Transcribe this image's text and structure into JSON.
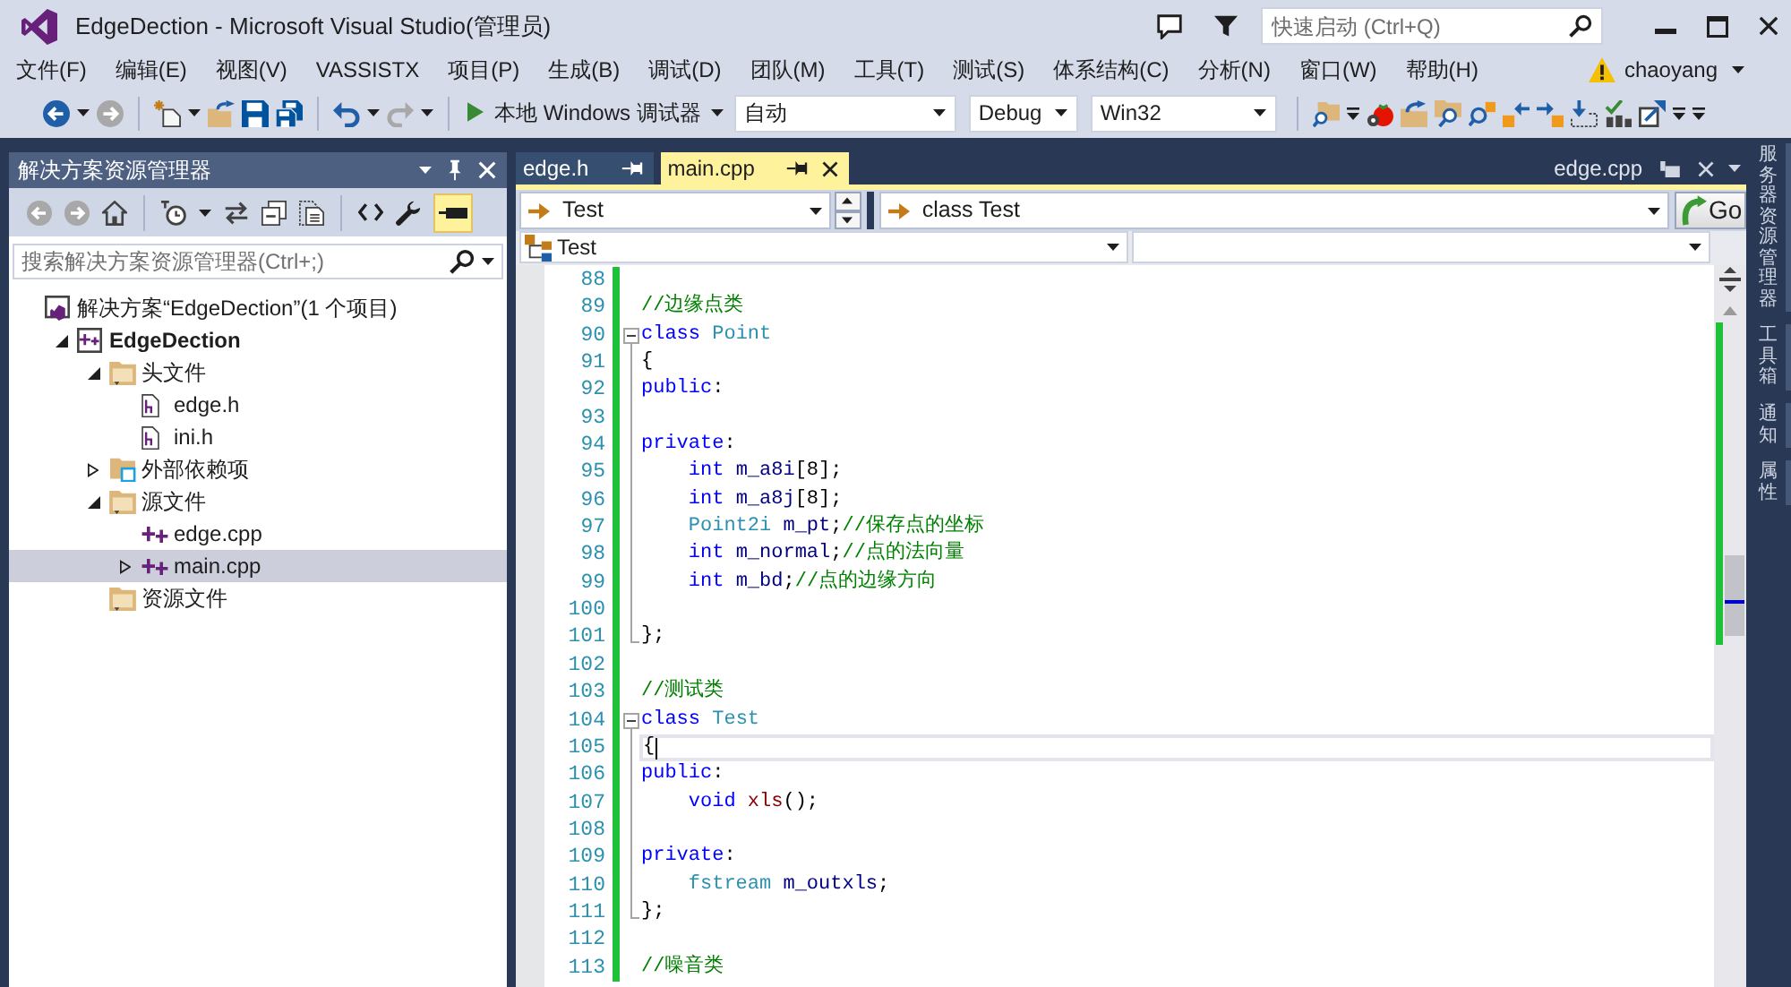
{
  "window": {
    "title": "EdgeDection - Microsoft Visual Studio(管理员)",
    "quick_launch": {
      "placeholder": "快速启动 (Ctrl+Q)"
    }
  },
  "menu": [
    "文件(F)",
    "编辑(E)",
    "视图(V)",
    "VASSISTX",
    "项目(P)",
    "生成(B)",
    "调试(D)",
    "团队(M)",
    "工具(T)",
    "测试(S)",
    "体系结构(C)",
    "分析(N)",
    "窗口(W)",
    "帮助(H)"
  ],
  "account": {
    "warning": true,
    "user": "chaoyang"
  },
  "toolbar": {
    "items": [
      {
        "kind": "back",
        "disabled": false,
        "menu": true
      },
      {
        "kind": "forward",
        "disabled": true
      },
      {
        "kind": "separator"
      },
      {
        "kind": "new-project",
        "disabled": false,
        "menu": true
      },
      {
        "kind": "open-file",
        "disabled": false
      },
      {
        "kind": "save",
        "disabled": false
      },
      {
        "kind": "save-all",
        "disabled": false
      },
      {
        "kind": "separator"
      },
      {
        "kind": "undo",
        "disabled": false,
        "menu": true
      },
      {
        "kind": "redo",
        "disabled": true,
        "menu": true
      },
      {
        "kind": "separator"
      },
      {
        "kind": "start",
        "label": "本地 Windows 调试器",
        "menu": true
      },
      {
        "kind": "debugger-type-combo",
        "value": "自动"
      },
      {
        "kind": "configuration-combo",
        "value": "Debug"
      },
      {
        "kind": "platform-combo",
        "value": "Win32"
      },
      {
        "kind": "separator"
      },
      {
        "kind": "find-in-files",
        "disabled": false
      },
      {
        "kind": "overflow"
      },
      {
        "kind": "tomato",
        "disabled": false
      },
      {
        "kind": "folder-arrow",
        "disabled": false
      },
      {
        "kind": "folder-magnifier",
        "disabled": false
      },
      {
        "kind": "magnifier",
        "disabled": false
      },
      {
        "kind": "arrow-left",
        "disabled": false
      },
      {
        "kind": "arrow-right",
        "disabled": false
      },
      {
        "kind": "arrow-down",
        "disabled": false
      },
      {
        "kind": "spell-check",
        "disabled": false
      },
      {
        "kind": "window-arrow",
        "disabled": false
      },
      {
        "kind": "overflow"
      },
      {
        "kind": "overflow"
      }
    ]
  },
  "solution_explorer": {
    "title": "解决方案资源管理器",
    "toolbar": [
      {
        "kind": "back",
        "disabled": true
      },
      {
        "kind": "forward",
        "disabled": true
      },
      {
        "kind": "home",
        "disabled": false
      },
      {
        "kind": "separator"
      },
      {
        "kind": "pending-changes",
        "disabled": false,
        "menu": true
      },
      {
        "kind": "sync",
        "disabled": false
      },
      {
        "kind": "collapse-all",
        "disabled": false
      },
      {
        "kind": "show-all-files",
        "disabled": false
      },
      {
        "kind": "separator"
      },
      {
        "kind": "view-code",
        "disabled": false
      },
      {
        "kind": "properties",
        "disabled": false
      },
      {
        "kind": "preview",
        "disabled": false,
        "on": true
      }
    ],
    "search": {
      "placeholder": "搜索解决方案资源管理器(Ctrl+;)"
    },
    "tree": [
      {
        "kind": "solution",
        "label": "解决方案“EdgeDection”(1 个项目)",
        "selected": false,
        "children": [
          {
            "kind": "project",
            "label": "EdgeDection",
            "expanded": true,
            "selected": false,
            "children": [
              {
                "kind": "filter",
                "label": "头文件",
                "expanded": true,
                "selected": false,
                "children": [
                  {
                    "kind": "header",
                    "label": "edge.h",
                    "selected": false
                  },
                  {
                    "kind": "header",
                    "label": "ini.h",
                    "selected": false
                  }
                ]
              },
              {
                "kind": "external",
                "label": "外部依赖项",
                "expanded": false,
                "selected": false
              },
              {
                "kind": "filter",
                "label": "源文件",
                "expanded": true,
                "selected": false,
                "children": [
                  {
                    "kind": "source",
                    "label": "edge.cpp",
                    "selected": false
                  },
                  {
                    "kind": "source",
                    "label": "main.cpp",
                    "expanded": false,
                    "selected": true
                  }
                ]
              },
              {
                "kind": "filter",
                "label": "资源文件",
                "selected": false
              }
            ]
          }
        ]
      }
    ]
  },
  "editor": {
    "tabs": [
      {
        "label": "edge.h",
        "selected": false
      },
      {
        "label": "main.cpp",
        "selected": true
      }
    ],
    "preview_tab": {
      "label": "edge.cpp"
    },
    "va_bar": {
      "context": "Test",
      "definition": "class Test",
      "go": "Go"
    },
    "nav_bar": {
      "scope": "Test"
    },
    "lines": [
      {
        "number": "88",
        "kind": "plain",
        "changed": true,
        "current": false
      },
      {
        "number": "89",
        "kind": "plain",
        "changed": true,
        "current": false,
        "tokens": [
          {
            "kind": "comment",
            "text": "//边缘点类"
          }
        ]
      },
      {
        "number": "90",
        "kind": "opener",
        "changed": true,
        "current": false,
        "tokens": [
          {
            "kind": "keyword",
            "text": "class"
          },
          {
            "kind": "type",
            "text": " Point"
          }
        ]
      },
      {
        "number": "91",
        "kind": "inner",
        "changed": true,
        "current": false,
        "tokens": [
          {
            "kind": "plain",
            "text": "{"
          }
        ]
      },
      {
        "number": "92",
        "kind": "inner",
        "changed": true,
        "current": false,
        "tokens": [
          {
            "kind": "keyword",
            "text": "public"
          },
          {
            "kind": "plain",
            "text": ":"
          }
        ]
      },
      {
        "number": "93",
        "kind": "inner",
        "changed": true,
        "current": false
      },
      {
        "number": "94",
        "kind": "inner",
        "changed": true,
        "current": false,
        "tokens": [
          {
            "kind": "keyword",
            "text": "private"
          },
          {
            "kind": "plain",
            "text": ":"
          }
        ]
      },
      {
        "number": "95",
        "kind": "inner",
        "changed": true,
        "current": false,
        "tokens": [
          {
            "kind": "keyword",
            "text": "    int"
          },
          {
            "kind": "member",
            "text": " m_a8i"
          },
          {
            "kind": "plain",
            "text": "[8];"
          }
        ]
      },
      {
        "number": "96",
        "kind": "inner",
        "changed": true,
        "current": false,
        "tokens": [
          {
            "kind": "keyword",
            "text": "    int"
          },
          {
            "kind": "member",
            "text": " m_a8j"
          },
          {
            "kind": "plain",
            "text": "[8];"
          }
        ]
      },
      {
        "number": "97",
        "kind": "inner",
        "changed": true,
        "current": false,
        "tokens": [
          {
            "kind": "type",
            "text": "    Point2i"
          },
          {
            "kind": "member",
            "text": " m_pt"
          },
          {
            "kind": "plain",
            "text": ";"
          },
          {
            "kind": "comment",
            "text": "//保存点的坐标"
          }
        ]
      },
      {
        "number": "98",
        "kind": "inner",
        "changed": true,
        "current": false,
        "tokens": [
          {
            "kind": "keyword",
            "text": "    int"
          },
          {
            "kind": "member",
            "text": " m_normal"
          },
          {
            "kind": "plain",
            "text": ";"
          },
          {
            "kind": "comment",
            "text": "//点的法向量"
          }
        ]
      },
      {
        "number": "99",
        "kind": "inner",
        "changed": true,
        "current": false,
        "tokens": [
          {
            "kind": "keyword",
            "text": "    int"
          },
          {
            "kind": "member",
            "text": " m_bd"
          },
          {
            "kind": "plain",
            "text": ";"
          },
          {
            "kind": "comment",
            "text": "//点的边缘方向"
          }
        ]
      },
      {
        "number": "100",
        "kind": "inner",
        "changed": true,
        "current": false
      },
      {
        "number": "101",
        "kind": "closer",
        "changed": true,
        "current": false,
        "tokens": [
          {
            "kind": "plain",
            "text": "};"
          }
        ]
      },
      {
        "number": "102",
        "kind": "plain",
        "changed": true,
        "current": false
      },
      {
        "number": "103",
        "kind": "plain",
        "changed": true,
        "current": false,
        "tokens": [
          {
            "kind": "comment",
            "text": "//测试类"
          }
        ]
      },
      {
        "number": "104",
        "kind": "opener",
        "changed": true,
        "current": false,
        "tokens": [
          {
            "kind": "keyword",
            "text": "class"
          },
          {
            "kind": "type",
            "text": " Test"
          }
        ]
      },
      {
        "number": "105",
        "kind": "inner",
        "changed": true,
        "current": true,
        "tokens": [
          {
            "kind": "plain",
            "text": "{"
          }
        ]
      },
      {
        "number": "106",
        "kind": "inner",
        "changed": true,
        "current": false,
        "tokens": [
          {
            "kind": "keyword",
            "text": "public"
          },
          {
            "kind": "plain",
            "text": ":"
          }
        ]
      },
      {
        "number": "107",
        "kind": "inner",
        "changed": true,
        "current": false,
        "tokens": [
          {
            "kind": "keyword",
            "text": "    void"
          },
          {
            "kind": "method",
            "text": " xls"
          },
          {
            "kind": "plain",
            "text": "();"
          }
        ]
      },
      {
        "number": "108",
        "kind": "inner",
        "changed": true,
        "current": false
      },
      {
        "number": "109",
        "kind": "inner",
        "changed": true,
        "current": false,
        "tokens": [
          {
            "kind": "keyword",
            "text": "private"
          },
          {
            "kind": "plain",
            "text": ":"
          }
        ]
      },
      {
        "number": "110",
        "kind": "inner",
        "changed": true,
        "current": false,
        "tokens": [
          {
            "kind": "type",
            "text": "    fstream"
          },
          {
            "kind": "member",
            "text": " m_outxls"
          },
          {
            "kind": "plain",
            "text": ";"
          }
        ]
      },
      {
        "number": "111",
        "kind": "closer",
        "changed": true,
        "current": false,
        "tokens": [
          {
            "kind": "plain",
            "text": "};"
          }
        ]
      },
      {
        "number": "112",
        "kind": "plain",
        "changed": true,
        "current": false
      },
      {
        "number": "113",
        "kind": "plain",
        "changed": true,
        "current": false,
        "tokens": [
          {
            "kind": "comment",
            "text": "//噪音类"
          }
        ]
      }
    ]
  },
  "side_tabs": [
    "服务器资源管理器",
    "工具箱",
    "通知",
    "属性"
  ]
}
